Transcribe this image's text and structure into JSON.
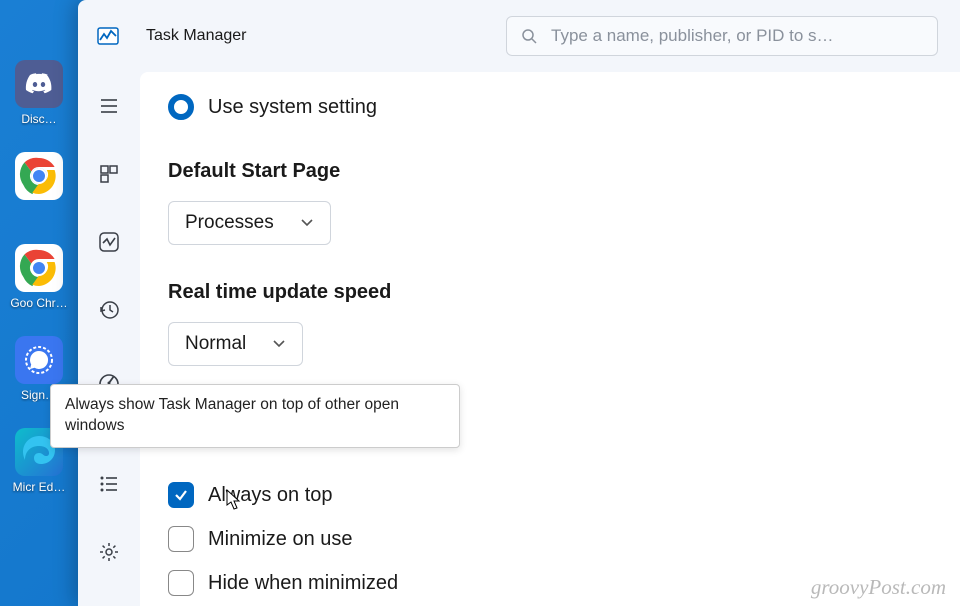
{
  "desktop": {
    "icons": [
      {
        "label": "Disc…"
      },
      {
        "label": ""
      },
      {
        "label": "Goo Chr…"
      },
      {
        "label": "Sign…"
      },
      {
        "label": "Micr Ed…"
      }
    ]
  },
  "app": {
    "title": "Task Manager",
    "search_placeholder": "Type a name, publisher, or PID to s…"
  },
  "settings": {
    "radio_label": "Use system setting",
    "start_page_heading": "Default Start Page",
    "start_page_value": "Processes",
    "update_speed_heading": "Real time update speed",
    "update_speed_value": "Normal",
    "always_on_top_label": "Always on top",
    "minimize_on_use_label": "Minimize on use",
    "hide_when_minimized_label": "Hide when minimized",
    "always_on_top_checked": true
  },
  "tooltip": "Always show Task Manager on top of other open windows",
  "watermark": "groovyPost.com"
}
